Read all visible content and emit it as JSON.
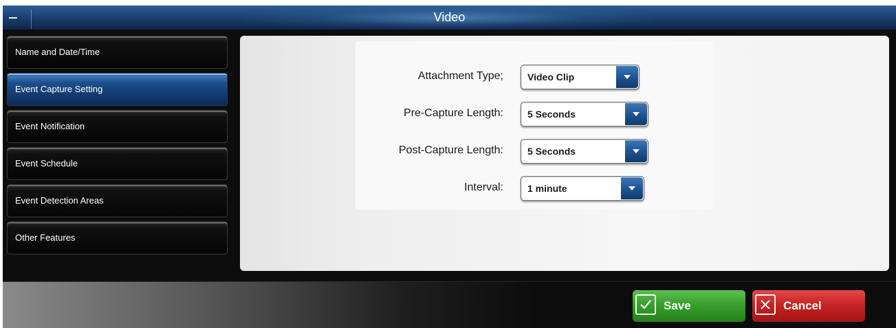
{
  "window": {
    "title": "Video",
    "minimize_icon": "minimize-icon"
  },
  "sidebar": {
    "items": [
      {
        "label": "Name and Date/Time",
        "active": false
      },
      {
        "label": "Event Capture Setting",
        "active": true
      },
      {
        "label": "Event Notification",
        "active": false
      },
      {
        "label": "Event Schedule",
        "active": false
      },
      {
        "label": "Event Detection Areas",
        "active": false
      },
      {
        "label": "Other Features",
        "active": false
      }
    ]
  },
  "form": {
    "fields": [
      {
        "label": "Attachment Type;",
        "value": "Video Clip"
      },
      {
        "label": "Pre-Capture Length:",
        "value": "5 Seconds"
      },
      {
        "label": "Post-Capture Length:",
        "value": "5 Seconds"
      },
      {
        "label": "Interval:",
        "value": "1 minute"
      }
    ],
    "dropdown_icon": "chevron-down-icon"
  },
  "actions": {
    "save_label": "Save",
    "save_icon": "checkmark-icon",
    "cancel_label": "Cancel",
    "cancel_icon": "close-icon"
  },
  "colors": {
    "title_bar": "#1c4272",
    "active_item": "#1c4d8c",
    "dropdown_arrow": "#1f5496",
    "save": "#38a02c",
    "cancel": "#c82424"
  }
}
